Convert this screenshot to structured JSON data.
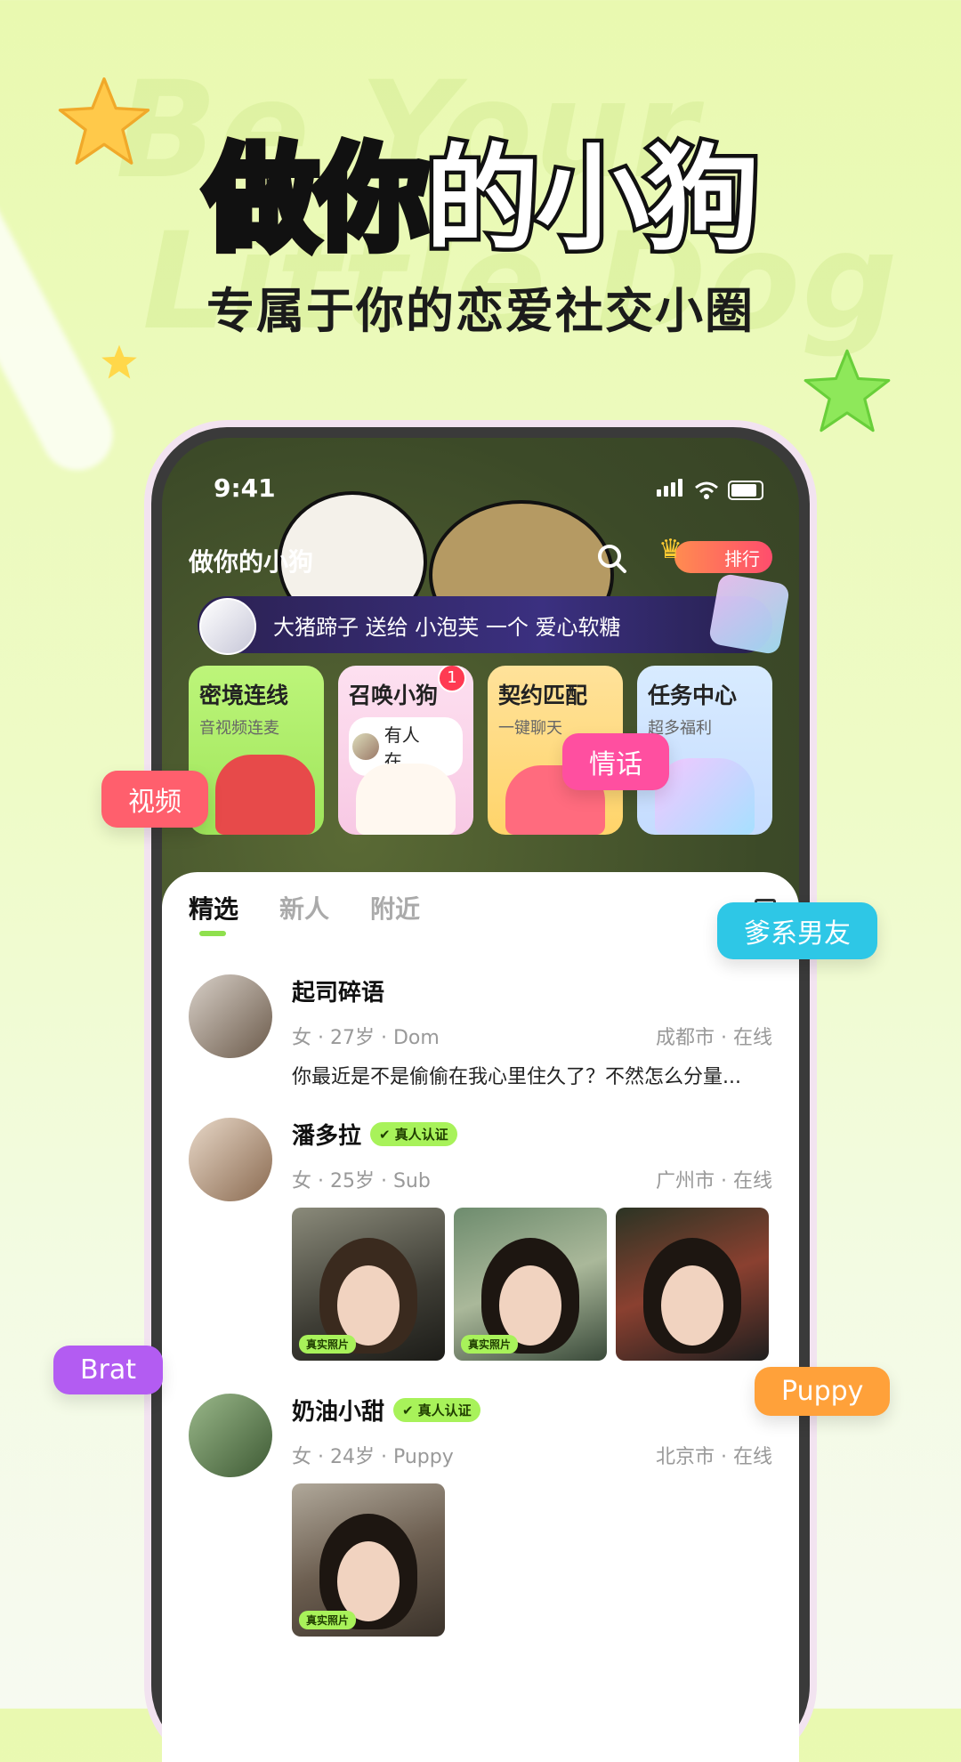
{
  "hero": {
    "watermark1": "Be Your",
    "watermark2": "Little Dog",
    "title_grad": "做你",
    "title_rest": "的小狗",
    "subtitle": "专属于你的恋爱社交小圈"
  },
  "status": {
    "time": "9:41"
  },
  "appbar": {
    "title": "做你的小狗",
    "rank_label": "排行"
  },
  "gift_banner": {
    "text": "大猪蹄子 送给 小泡芙 一个 爱心软糖"
  },
  "cards": [
    {
      "title": "密境连线",
      "sub": "音视频连麦"
    },
    {
      "title": "召唤小狗",
      "sub": "有人在...",
      "badge": "1"
    },
    {
      "title": "契约匹配",
      "sub": "一键聊天"
    },
    {
      "title": "任务中心",
      "sub": "超多福利"
    }
  ],
  "tabs": [
    "精选",
    "新人",
    "附近"
  ],
  "posts": [
    {
      "name": "起司碎语",
      "meta": "女 · 27岁 · Dom",
      "location": "成都市 · 在线",
      "message": "你最近是不是偷偷在我心里住久了？不然怎么分量..."
    },
    {
      "name": "潘多拉",
      "verified": "真人认证",
      "meta": "女 · 25岁 · Sub",
      "location": "广州市 · 在线",
      "photo_tag": "真实照片"
    },
    {
      "name": "奶油小甜",
      "verified": "真人认证",
      "meta": "女 · 24岁 · Puppy",
      "location": "北京市 · 在线",
      "photo_tag": "真实照片"
    }
  ],
  "bubbles": {
    "video": "视频",
    "love": "情话",
    "daddy": "爹系男友",
    "brat": "Brat",
    "puppy": "Puppy"
  },
  "colors": {
    "accent_green": "#a8f25a",
    "badge_red": "#ff3a52",
    "bubble_video": "#ff5f6d",
    "bubble_love": "#ff4fa0",
    "bubble_daddy": "#2ec7e6",
    "bubble_brat": "#b35cf2",
    "bubble_puppy": "#ffa13a"
  },
  "icons": [
    "star-icon",
    "search-icon",
    "crown-icon",
    "signal-icon",
    "wifi-icon",
    "battery-icon",
    "bookmark-icon",
    "check-circle-icon"
  ]
}
